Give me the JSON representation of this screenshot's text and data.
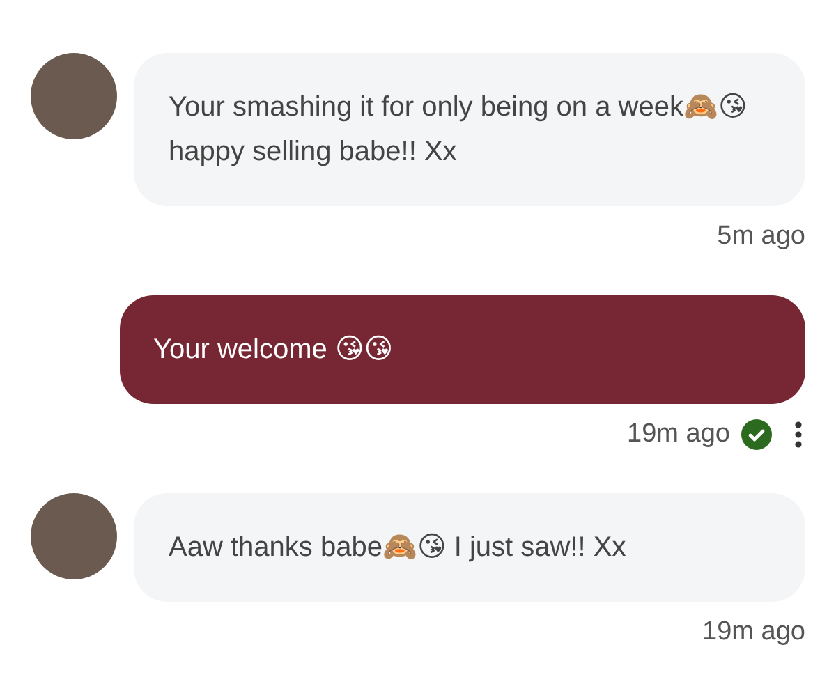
{
  "messages": [
    {
      "kind": "received",
      "text": "Your smashing it for only being on a week🙈😘 happy selling babe!! Xx",
      "time": "5m ago",
      "read": false
    },
    {
      "kind": "sent",
      "text": "Your welcome 😘😘",
      "time": "19m ago",
      "read": true
    },
    {
      "kind": "received",
      "text": "Aaw thanks babe🙈😘 I just saw!! Xx",
      "time": "19m ago",
      "read": false
    }
  ]
}
